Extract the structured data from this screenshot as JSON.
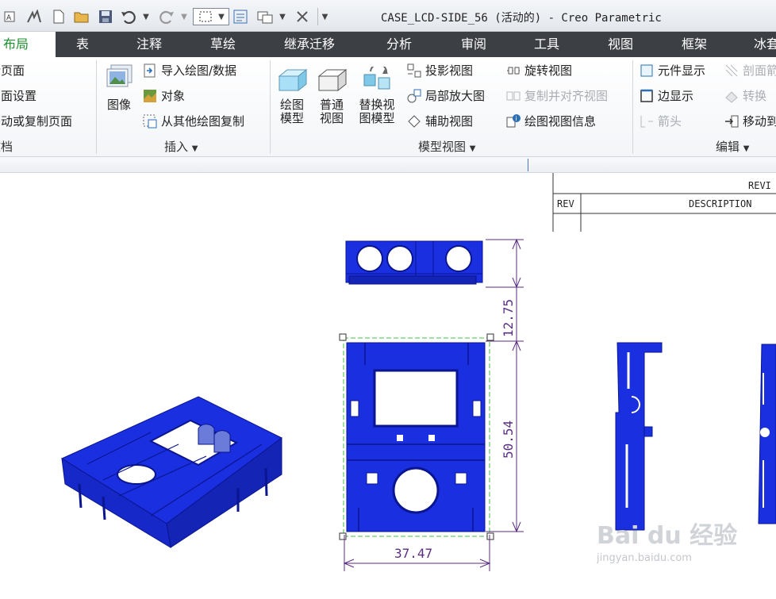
{
  "window": {
    "title": "CASE_LCD-SIDE_56 (活动的) - Creo Parametric"
  },
  "quick_access": [
    "new-icon",
    "open-icon",
    "save-icon",
    "undo-icon",
    "redo-icon",
    "select-box-icon",
    "regenerate-icon",
    "windows-icon",
    "close-window-icon",
    "customize-icon"
  ],
  "tabs": [
    {
      "label": "布局",
      "active": true
    },
    {
      "label": "表"
    },
    {
      "label": "注释"
    },
    {
      "label": "草绘"
    },
    {
      "label": "继承迁移"
    },
    {
      "label": "分析"
    },
    {
      "label": "审阅"
    },
    {
      "label": "工具"
    },
    {
      "label": "视图"
    },
    {
      "label": "框架"
    },
    {
      "label": "冰套"
    }
  ],
  "ribbon": {
    "doc": {
      "new_page": "新页面",
      "page_setup": "页面设置",
      "move_copy_page": "移动或复制页面",
      "group": "文档"
    },
    "insert": {
      "image": "图像",
      "import_drawing": "导入绘图/数据",
      "object": "对象",
      "copy_from_other": "从其他绘图复制",
      "group": "插入"
    },
    "model_views": {
      "drawing_model": "绘图\n模型",
      "general_view": "普通\n视图",
      "replace_view_model": "替换视\n图模型",
      "projection_view": "投影视图",
      "detailed_view": "局部放大图",
      "auxiliary_view": "辅助视图",
      "revolved_view": "旋转视图",
      "copy_align_view": "复制并对齐视图",
      "drawing_view_info": "绘图视图信息",
      "group": "模型视图"
    },
    "edit": {
      "component_display": "元件显示",
      "edge_display": "边显示",
      "arrow": "箭头",
      "section": "剖面箭",
      "convert": "转换",
      "move_to": "移动到",
      "group": "编辑"
    }
  },
  "revision_block": {
    "header": "REVI",
    "col_rev": "REV",
    "col_description": "DESCRIPTION"
  },
  "dimensions": {
    "top_height": "12.75",
    "front_height": "50.54",
    "front_width": "37.47"
  },
  "colors": {
    "model_blue": "#1a2fe0",
    "dimension": "#5a2d82",
    "tab_bar": "#3c3f44",
    "active_tab_text": "#1e8f2e",
    "selection_frame": "#3fbf3f"
  },
  "watermark": {
    "logo": "Bai du 经验",
    "url": "jingyan.baidu.com"
  }
}
